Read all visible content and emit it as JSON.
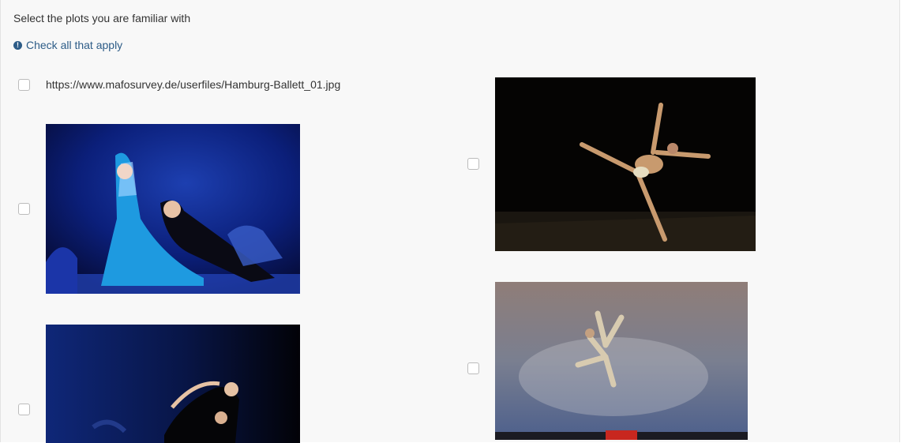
{
  "question": {
    "title": "Select the plots you are familiar with",
    "hint": "Check all that apply",
    "hint_icon": "exclamation-circle-icon"
  },
  "options": [
    {
      "label": "https://www.mafosurvey.de/userfiles/Hamburg-Ballett_01.jpg",
      "checked": false
    },
    {
      "image": "ballet dancer in blue gown with partner",
      "checked": false
    },
    {
      "image": "solo dancer arabesque on dark stage",
      "checked": false
    },
    {
      "image": "dancers on dark blue stage",
      "checked": false
    },
    {
      "image": "dancer leaping in patterned costume",
      "checked": false
    }
  ],
  "colors": {
    "panel_bg": "#f8f8f8",
    "text": "#333333",
    "hint": "#2d5c87",
    "checkbox_border": "#bcbcbc"
  }
}
